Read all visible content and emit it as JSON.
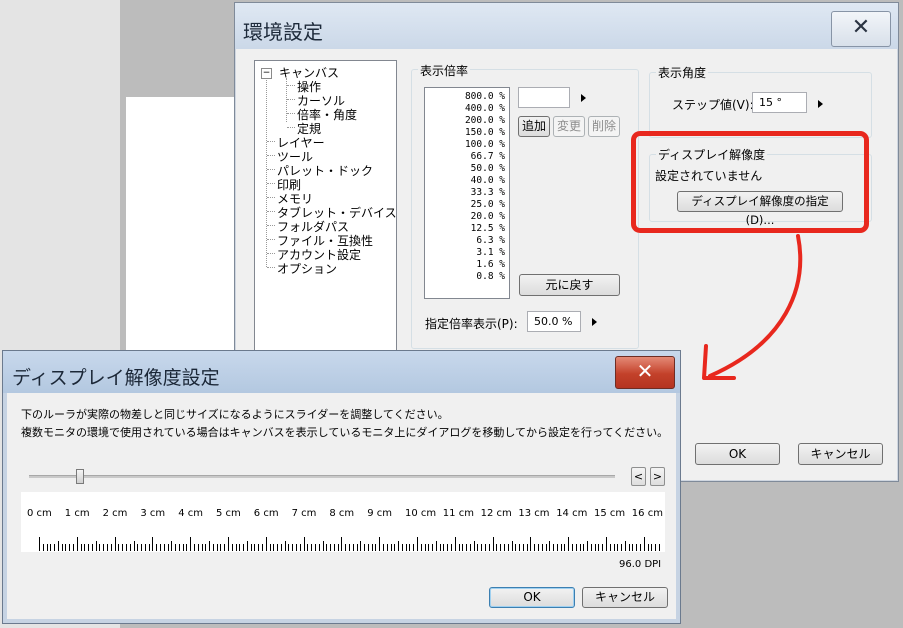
{
  "settings_window": {
    "title": "環境設定",
    "close_glyph": "✕",
    "tree": {
      "root": "キャンバス",
      "root_toggle": "−",
      "children": [
        "操作",
        "カーソル",
        "倍率・角度",
        "定規"
      ],
      "items": [
        "レイヤー",
        "ツール",
        "パレット・ドック",
        "印刷",
        "メモリ",
        "タブレット・デバイス",
        "フォルダパス",
        "ファイル・互換性",
        "アカウント設定",
        "オプション"
      ]
    },
    "zoom": {
      "group_label": "表示倍率",
      "list": [
        "800.0 %",
        "400.0 %",
        "200.0 %",
        "150.0 %",
        "100.0 %",
        "66.7 %",
        "50.0 %",
        "40.0 %",
        "33.3 %",
        "25.0 %",
        "20.0 %",
        "12.5 %",
        "6.3 %",
        "3.1 %",
        "1.6 %",
        "0.8 %"
      ],
      "input_value": "",
      "add_label": "追加",
      "change_label": "変更",
      "delete_label": "削除",
      "reset_label": "元に戻す",
      "specified_label": "指定倍率表示(P):",
      "specified_value": "50.0 %"
    },
    "angle": {
      "group_label": "表示角度",
      "step_label": "ステップ値(V):",
      "step_value": "15 °"
    },
    "display_resolution": {
      "group_label": "ディスプレイ解像度",
      "status": "設定されていません",
      "button_label": "ディスプレイ解像度の指定(D)..."
    },
    "ok_label": "OK",
    "cancel_label": "キャンセル"
  },
  "dialog": {
    "title": "ディスプレイ解像度設定",
    "close_glyph": "✕",
    "description_line1": "下のルーラが実際の物差しと同じサイズになるようにスライダーを調整してください。",
    "description_line2": "複数モニタの環境で使用されている場合はキャンバスを表示しているモニタ上にダイアログを移動してから設定を行ってください。",
    "slider_level": 0.08,
    "decrease_glyph": "<",
    "increase_glyph": ">",
    "ruler_labels": [
      "0 cm",
      "1 cm",
      "2 cm",
      "3 cm",
      "4 cm",
      "5 cm",
      "6 cm",
      "7 cm",
      "8 cm",
      "9 cm",
      "10 cm",
      "11 cm",
      "12 cm",
      "13 cm",
      "14 cm",
      "15 cm",
      "16 cm"
    ],
    "dpi": "96.0 DPI",
    "ok_label": "OK",
    "cancel_label": "キャンセル"
  },
  "colors": {
    "highlight": "#e8281e",
    "arrow": "#e8281e"
  }
}
